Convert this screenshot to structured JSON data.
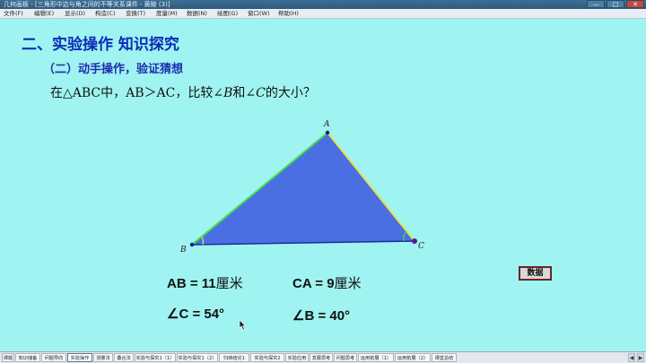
{
  "window": {
    "title": "几何画板 - [三角形中边与角之间的不等关系课件 - 黄陂 (3)]",
    "minimize": "—",
    "maximize": "□",
    "close": "✕"
  },
  "menu": [
    "文件(F)",
    "编辑(E)",
    "显示(D)",
    "构造(C)",
    "变换(T)",
    "度量(M)",
    "数据(N)",
    "绘图(G)",
    "窗口(W)",
    "帮助(H)"
  ],
  "page": {
    "heading": "二、实验操作  知识探究",
    "subheading": "（二）动手操作，验证猜想",
    "question_prefix": "在△ABC中，AB＞AC，比较∠",
    "question_b": "B",
    "question_mid": "和∠",
    "question_c": "C",
    "question_suffix": "的大小？"
  },
  "figure": {
    "vertex_a": "A",
    "vertex_b": "B",
    "vertex_c": "C",
    "fill": "#4a6fe3",
    "side_ab_color": "#41e041",
    "side_ca_color": "#e6e04a"
  },
  "measurements": {
    "ab_label": "AB = 11",
    "ab_unit": "厘米",
    "ca_label": "CA = 9",
    "ca_unit": "厘米",
    "angle_c": "∠C = 54°",
    "angle_b": "∠B = 40°"
  },
  "data_button": "数据",
  "tabs": [
    "课题",
    "知识储备",
    "问题导向",
    "实验操作",
    "测量法",
    "叠合法",
    "实验与探究1（1）",
    "实验与探究1（2）",
    "归纳结论1",
    "实验与探究2",
    "实验应用",
    "发展思考",
    "问题思考",
    "运用拓展（1）",
    "运用拓展（2）",
    "课堂总结"
  ],
  "active_tab": "实验操作"
}
